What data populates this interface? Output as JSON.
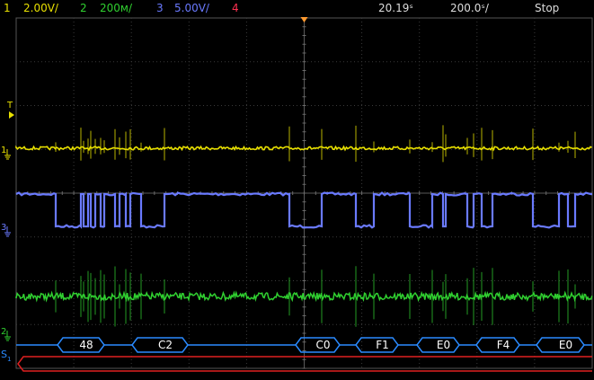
{
  "topbar": {
    "ch1": {
      "num": "1",
      "scale": "2.00V/",
      "color": "#e8e000"
    },
    "ch2": {
      "num": "2",
      "scale": "200ᴍ/",
      "color": "#30d030"
    },
    "ch3": {
      "num": "3",
      "scale": "5.00V/",
      "color": "#6a7aff"
    },
    "ch4": {
      "num": "4",
      "color": "#ff3050"
    },
    "time_pos": "20.19ˢ",
    "time_scale": "200.0ˢ/",
    "run_state": "Stop"
  },
  "markers": {
    "trigger": "T",
    "ch1": "1",
    "ch3": "3",
    "ch2": "2",
    "serial": "S",
    "serial_sub": "1"
  },
  "colors": {
    "grid": "#3a3a3a",
    "trigger_marker": "#ff9a30",
    "bus_line": "#2a8aff",
    "bus_text": "#ffffff",
    "serial_red": "#e02020"
  },
  "decode": {
    "packets": [
      {
        "label": "48"
      },
      {
        "label": "C2"
      },
      {
        "label": "C0"
      },
      {
        "label": "F1"
      },
      {
        "label": "E0"
      },
      {
        "label": "F4"
      },
      {
        "label": "E0"
      }
    ]
  }
}
